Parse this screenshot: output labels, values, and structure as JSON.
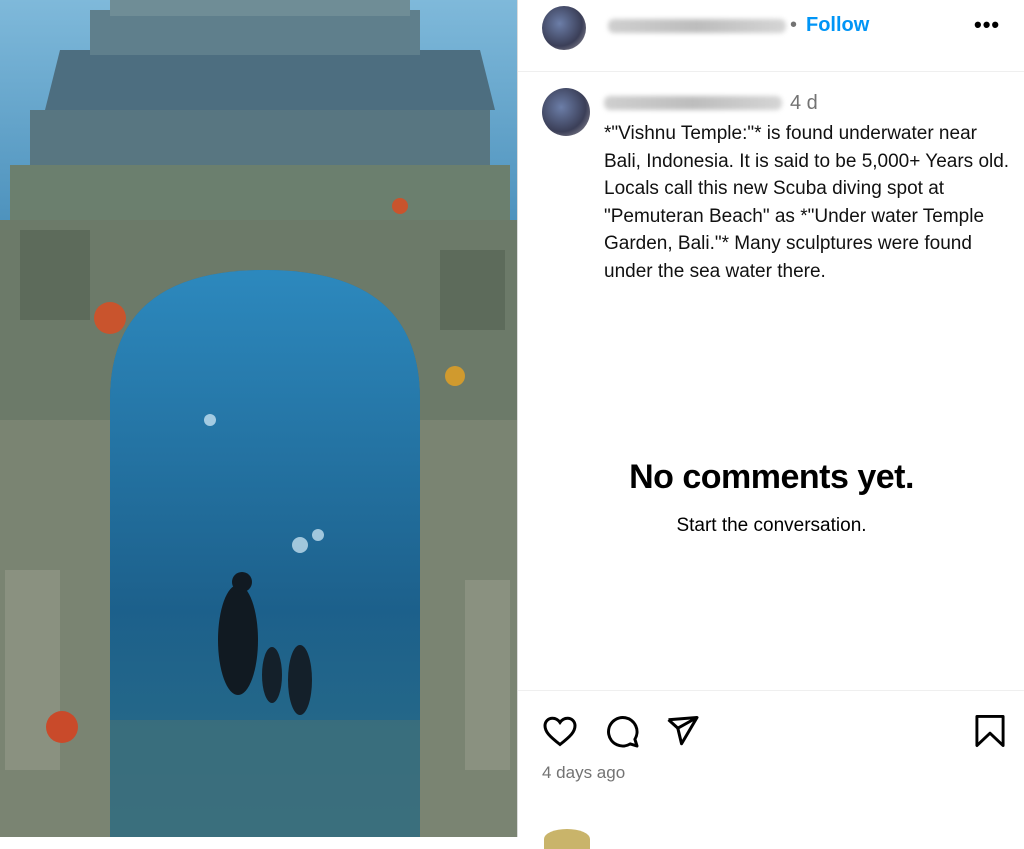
{
  "post": {
    "image_description_icon": "underwater-temple-photo",
    "header": {
      "follow_label": "Follow",
      "separator": "•",
      "more_label": "•••"
    },
    "caption": {
      "age": "4 d",
      "text": "*\"Vishnu Temple:\"* is found underwater near Bali, Indonesia. It is said to be 5,000+ Years old.\nLocals call this new Scuba diving spot at \"Pemuteran Beach\" as *\"Under water Temple Garden, Bali.\"* Many sculptures were found under the sea water there."
    },
    "comments": {
      "empty_title": "No comments yet.",
      "empty_subtitle": "Start the conversation."
    },
    "actions": {
      "icons": [
        "heart-icon",
        "comment-icon",
        "share-icon",
        "bookmark-icon"
      ]
    },
    "posted_ago": "4 days ago"
  },
  "colors": {
    "follow": "#0095f6",
    "muted": "#737373"
  }
}
